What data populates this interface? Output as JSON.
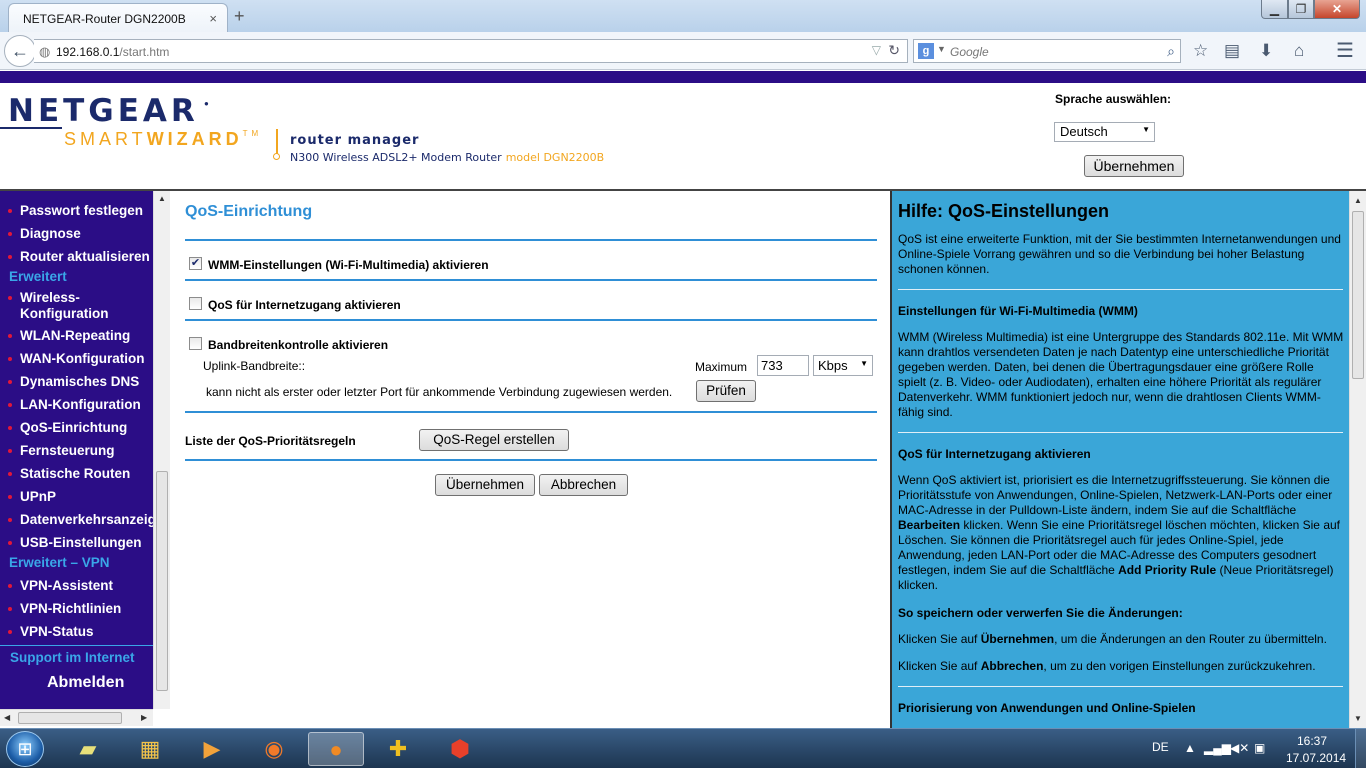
{
  "browser": {
    "tab_title": "NETGEAR-Router DGN2200B",
    "tab_close": "×",
    "new_tab": "+",
    "url_host": "192.168.0.1",
    "url_path": "/start.htm",
    "search_placeholder": "Google",
    "window_buttons": {
      "minimize": "▁",
      "maximize": "❐",
      "close": "✕"
    }
  },
  "header": {
    "brand": "NETGEAR",
    "smart": "SMART",
    "wizard": "WIZARD",
    "tm": "TM",
    "router_manager": "router manager",
    "model_line": "N300 Wireless ADSL2+ Modem Router",
    "model_name": "model DGN2200B",
    "language_label": "Sprache auswählen:",
    "language_value": "Deutsch",
    "language_apply": "Übernehmen"
  },
  "sidebar": {
    "items_top": [
      "Passwort festlegen",
      "Diagnose",
      "Router aktualisieren"
    ],
    "section_advanced": "Erweitert",
    "items_advanced": [
      "Wireless-Konfiguration",
      "WLAN-Repeating",
      "WAN-Konfiguration",
      "Dynamisches DNS",
      "LAN-Konfiguration",
      "QoS-Einrichtung",
      "Fernsteuerung",
      "Statische Routen",
      "UPnP",
      "Datenverkehrsanzeige",
      "USB-Einstellungen"
    ],
    "section_vpn": "Erweitert – VPN",
    "items_vpn": [
      "VPN-Assistent",
      "VPN-Richtlinien",
      "VPN-Status"
    ],
    "support": "Support im Internet",
    "logout": "Abmelden"
  },
  "main": {
    "title": "QoS-Einrichtung",
    "wmm_label": "WMM-Einstellungen (Wi-Fi-Multimedia) aktivieren",
    "wmm_checked": true,
    "qos_label": "QoS für Internetzugang aktivieren",
    "qos_checked": false,
    "bw_label": "Bandbreitenkontrolle aktivieren",
    "bw_checked": false,
    "uplink_label": "Uplink-Bandbreite::",
    "maximum_label": "Maximum",
    "uplink_value": "733",
    "unit_value": "Kbps",
    "port_text": "kann nicht als erster oder letzter Port für ankommende Verbindung zugewiesen werden.",
    "check_button": "Prüfen",
    "rules_label": "Liste der QoS-Prioritätsregeln",
    "create_rule_button": "QoS-Regel erstellen",
    "apply_button": "Übernehmen",
    "cancel_button": "Abbrechen"
  },
  "help": {
    "title": "Hilfe: QoS-Einstellungen",
    "intro": "QoS ist eine erweiterte Funktion, mit der Sie bestimmten Internetanwendungen und Online-Spiele Vorrang gewähren und so die Verbindung bei hoher Belastung schonen können.",
    "wmm_heading": "Einstellungen für Wi-Fi-Multimedia (WMM)",
    "wmm_text": "WMM (Wireless Multimedia) ist eine Untergruppe des Standards 802.11e. Mit WMM kann drahtlos versendeten Daten je nach Datentyp eine unterschiedliche Priorität gegeben werden. Daten, bei denen die Übertragungsdauer eine größere Rolle spielt (z. B. Video- oder Audiodaten), erhalten eine höhere Priorität als regulärer Datenverkehr. WMM funktioniert jedoch nur, wenn die drahtlosen Clients WMM-fähig sind.",
    "qos_heading": "QoS für Internetzugang aktivieren",
    "qos_text_1": "Wenn QoS aktiviert ist, priorisiert es die Internetzugriffssteuerung. Sie können die Prioritätsstufe von Anwendungen, Online-Spielen, Netzwerk-LAN-Ports oder einer MAC-Adresse in der Pulldown-Liste ändern, indem Sie auf die Schaltfläche ",
    "qos_bold_1": "Bearbeiten",
    "qos_text_2": " klicken. Wenn Sie eine Prioritätsregel löschen möchten, klicken Sie auf Löschen. Sie können die Prioritätsregel auch für jedes Online-Spiel, jede Anwendung, jeden LAN-Port oder die MAC-Adresse des Computers gesodnert festlegen, indem Sie auf die Schaltfläche ",
    "qos_bold_2": "Add Priority Rule",
    "qos_text_3": " (Neue Prioritätsregel) klicken.",
    "save_heading": "So speichern oder verwerfen Sie die Änderungen:",
    "save_text_1": "Klicken Sie auf ",
    "save_bold": "Übernehmen",
    "save_text_2": ", um die Änderungen an den Router zu übermitteln.",
    "cancel_text_1": "Klicken Sie auf ",
    "cancel_bold": "Abbrechen",
    "cancel_text_2": ", um zu den vorigen Einstellungen zurückzukehren.",
    "priority_heading": "Priorisierung von Anwendungen und Online-Spielen"
  },
  "taskbar": {
    "language": "DE",
    "time": "16:37",
    "date": "17.07.2014",
    "apps": [
      "explorer",
      "libraries",
      "media-player",
      "origin",
      "firefox",
      "game",
      "app-14"
    ]
  }
}
